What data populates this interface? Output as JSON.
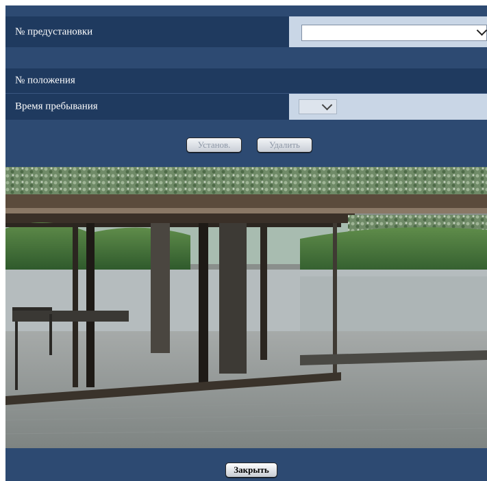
{
  "preset": {
    "label": "№ предустановки",
    "value": ""
  },
  "position": {
    "label": "№ положения"
  },
  "dwell": {
    "label": "Время пребывания",
    "value": ""
  },
  "buttons": {
    "set": "Установ.",
    "delete": "Удалить",
    "close": "Закрыть"
  },
  "colors": {
    "panel_dark": "#1f3a5f",
    "panel_mid": "#2d4a72",
    "input_area": "#c9d6e6"
  },
  "camera": {
    "image": "camera-live-view"
  }
}
